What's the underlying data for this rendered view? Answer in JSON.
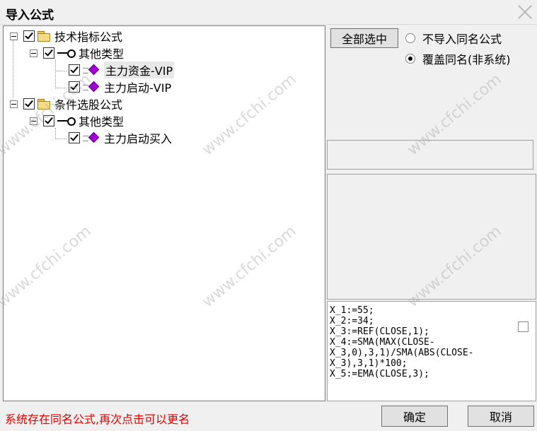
{
  "window": {
    "title": "导入公式"
  },
  "tree": {
    "nodes": [
      {
        "label": "技术指标公式"
      },
      {
        "label": "其他类型"
      },
      {
        "label": "主力资金-VIP"
      },
      {
        "label": "主力启动-VIP"
      },
      {
        "label": "条件选股公式"
      },
      {
        "label": "其他类型"
      },
      {
        "label": "主力启动买入"
      }
    ]
  },
  "options": {
    "select_all_label": "全部选中",
    "radio_no_import": "不导入同名公式",
    "radio_overwrite": "覆盖同名(非系统)"
  },
  "code": {
    "text": "X_1:=55;\nX_2:=34;\nX_3:=REF(CLOSE,1);\nX_4:=SMA(MAX(CLOSE-\nX_3,0),3,1)/SMA(ABS(CLOSE-\nX_3),3,1)*100;\nX_5:=EMA(CLOSE,3);"
  },
  "status": {
    "message": "系统存在同名公式,再次点击可以更名"
  },
  "buttons": {
    "ok": "确定",
    "cancel": "取消"
  },
  "watermark": {
    "text": "www.cfchi.com"
  }
}
